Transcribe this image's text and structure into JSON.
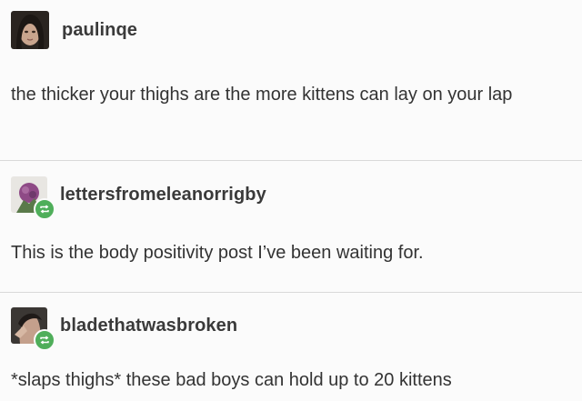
{
  "posts": [
    {
      "username": "paulinqe",
      "text": "the thicker your thighs are the more kittens can lay on your lap"
    },
    {
      "username": "lettersfromeleanorrigby",
      "text": "This is the body positivity post I’ve been waiting for."
    },
    {
      "username": "bladethatwasbroken",
      "text": "*slaps thighs* these bad boys can hold up to 20 kittens"
    }
  ],
  "colors": {
    "background": "#fbfbfb",
    "divider": "#d9d9d9",
    "reblog_badge": "#4fae5a"
  }
}
